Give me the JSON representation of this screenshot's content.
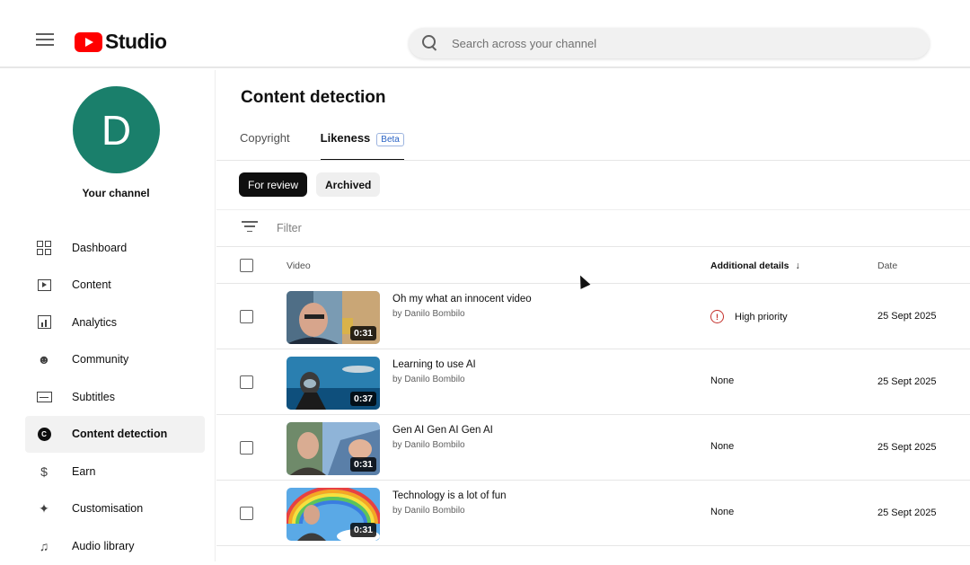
{
  "header": {
    "logo_text": "Studio",
    "search_placeholder": "Search across your channel"
  },
  "sidebar": {
    "avatar_letter": "D",
    "channel_label": "Your channel",
    "items": [
      {
        "label": "Dashboard",
        "icon": "dashboard-icon"
      },
      {
        "label": "Content",
        "icon": "content-icon"
      },
      {
        "label": "Analytics",
        "icon": "analytics-icon"
      },
      {
        "label": "Community",
        "icon": "community-icon"
      },
      {
        "label": "Subtitles",
        "icon": "subtitles-icon"
      },
      {
        "label": "Content detection",
        "icon": "content-detection-icon",
        "active": true
      },
      {
        "label": "Earn",
        "icon": "dollar-icon"
      },
      {
        "label": "Customisation",
        "icon": "magic-wand-icon"
      },
      {
        "label": "Audio library",
        "icon": "audio-library-icon"
      }
    ]
  },
  "main": {
    "title": "Content detection",
    "tabs": [
      {
        "label": "Copyright"
      },
      {
        "label": "Likeness",
        "badge": "Beta",
        "active": true
      }
    ],
    "chips": [
      {
        "label": "For review",
        "active": true
      },
      {
        "label": "Archived"
      }
    ],
    "filter_placeholder": "Filter",
    "columns": {
      "video": "Video",
      "details": "Additional details",
      "date": "Date"
    },
    "rows": [
      {
        "title": "Oh my what an innocent video",
        "by": "by Danilo Bombilo",
        "duration": "0:31",
        "details": "High priority",
        "priority": true,
        "date": "25 Sept 2025"
      },
      {
        "title": "Learning to use AI",
        "by": "by Danilo Bombilo",
        "duration": "0:37",
        "details": "None",
        "date": "25 Sept 2025"
      },
      {
        "title": "Gen AI Gen AI Gen AI",
        "by": "by Danilo Bombilo",
        "duration": "0:31",
        "details": "None",
        "date": "25 Sept 2025"
      },
      {
        "title": "Technology is a lot of fun",
        "by": "by Danilo Bombilo",
        "duration": "0:31",
        "details": "None",
        "date": "25 Sept 2025"
      }
    ]
  },
  "colors": {
    "brand_red": "#ff0000",
    "avatar_bg": "#1a7f6b",
    "priority_red": "#c4302b",
    "badge_blue": "#2a63c5"
  }
}
